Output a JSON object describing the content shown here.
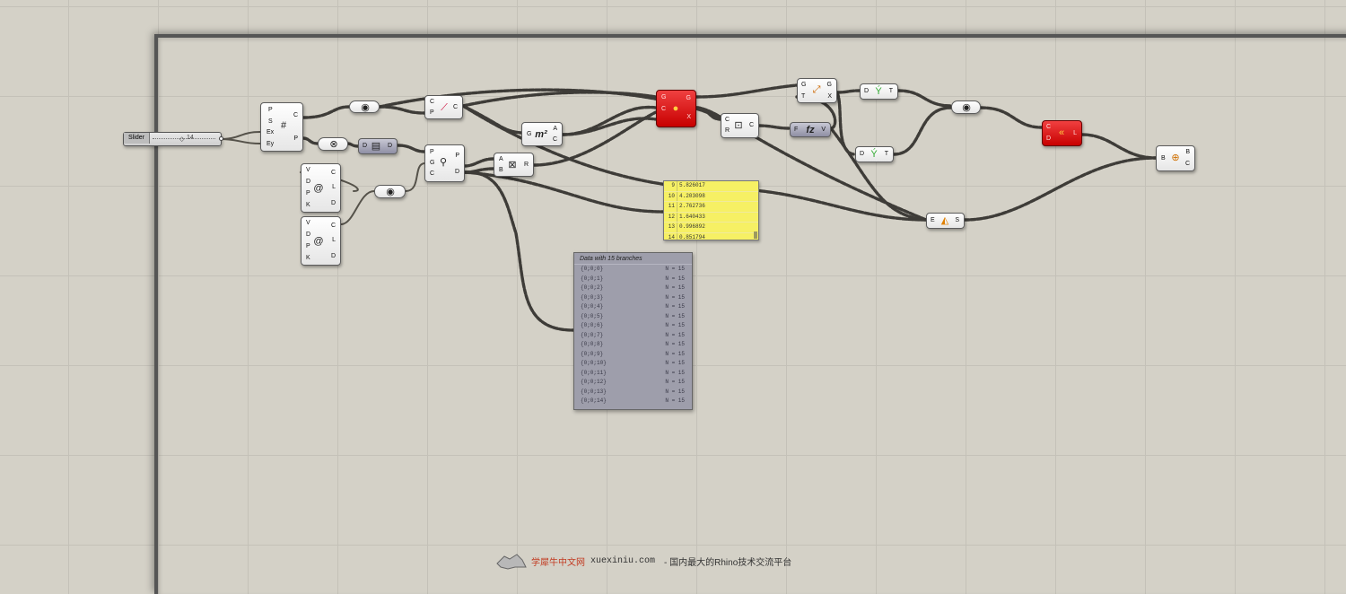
{
  "slider": {
    "label": "Slider",
    "value": "14"
  },
  "components": {
    "rect_grid": {
      "inputs": [
        "P",
        "S",
        "Ex",
        "Ey"
      ],
      "outputs": [
        "C",
        "P"
      ]
    },
    "curve_pipe": {
      "inputs": [
        "C",
        "P"
      ],
      "outputs": [
        "C"
      ]
    },
    "negative": {
      "inputs": [
        "D"
      ],
      "outputs": [
        "D"
      ]
    },
    "populate": {
      "inputs": [
        "P",
        "G",
        "C"
      ],
      "outputs": [
        "P",
        "D"
      ]
    },
    "circle_a": {
      "inputs": [
        "V",
        "D",
        "P",
        "K"
      ],
      "outputs": [
        "C",
        "L",
        "D"
      ]
    },
    "circle_b": {
      "inputs": [
        "V",
        "D",
        "P",
        "K"
      ],
      "outputs": [
        "C",
        "L",
        "D"
      ]
    },
    "area": {
      "inputs": [
        "G"
      ],
      "outputs": [
        "A",
        "C"
      ]
    },
    "multiply": {
      "inputs": [
        "A",
        "B"
      ],
      "outputs": [
        "R"
      ]
    },
    "centroid_red": {
      "inputs": [
        "G",
        "C"
      ],
      "outputs": [
        "G",
        "X"
      ]
    },
    "boundary": {
      "inputs": [
        "C",
        "R"
      ],
      "outputs": [
        "C"
      ]
    },
    "fz": {
      "inputs": [
        "F"
      ],
      "outputs": [
        "V"
      ]
    },
    "deconstruct": {
      "inputs": [
        "G",
        "T"
      ],
      "outputs": [
        "G",
        "X"
      ]
    },
    "tree_top": {
      "inputs": [
        "D"
      ],
      "outputs": [
        "T"
      ]
    },
    "tree_bottom": {
      "inputs": [
        "D"
      ],
      "outputs": [
        "T"
      ]
    },
    "sort_red": {
      "inputs": [
        "C",
        "D"
      ],
      "outputs": [
        "L"
      ]
    },
    "bounds": {
      "inputs": [
        "E"
      ],
      "outputs": [
        "S"
      ]
    },
    "brep": {
      "inputs": [
        "B"
      ],
      "outputs": [
        "B",
        "C"
      ]
    }
  },
  "yellow_panel": [
    {
      "index": "9",
      "value": "5.826017"
    },
    {
      "index": "10",
      "value": "4.203098"
    },
    {
      "index": "11",
      "value": "2.762736"
    },
    {
      "index": "12",
      "value": "1.640433"
    },
    {
      "index": "13",
      "value": "0.996892"
    },
    {
      "index": "14",
      "value": "0.851794"
    }
  ],
  "data_panel": {
    "title": "Data with 15 branches",
    "rows": [
      {
        "path": "{0;0;0}",
        "count": "N = 15"
      },
      {
        "path": "{0;0;1}",
        "count": "N = 15"
      },
      {
        "path": "{0;0;2}",
        "count": "N = 15"
      },
      {
        "path": "{0;0;3}",
        "count": "N = 15"
      },
      {
        "path": "{0;0;4}",
        "count": "N = 15"
      },
      {
        "path": "{0;0;5}",
        "count": "N = 15"
      },
      {
        "path": "{0;0;6}",
        "count": "N = 15"
      },
      {
        "path": "{0;0;7}",
        "count": "N = 15"
      },
      {
        "path": "{0;0;8}",
        "count": "N = 15"
      },
      {
        "path": "{0;0;9}",
        "count": "N = 15"
      },
      {
        "path": "{0;0;10}",
        "count": "N = 15"
      },
      {
        "path": "{0;0;11}",
        "count": "N = 15"
      },
      {
        "path": "{0;0;12}",
        "count": "N = 15"
      },
      {
        "path": "{0;0;13}",
        "count": "N = 15"
      },
      {
        "path": "{0;0;14}",
        "count": "N = 15"
      }
    ]
  },
  "watermark": {
    "brand": "学犀牛中文网",
    "site": "xuexiniu.com",
    "tagline": "- 国内最大的Rhino技术交流平台"
  },
  "colors": {
    "canvas": "#d4d1c7",
    "component_red": "#d41010",
    "panel_yellow": "#f6f064",
    "panel_gray": "#9e9eab"
  }
}
